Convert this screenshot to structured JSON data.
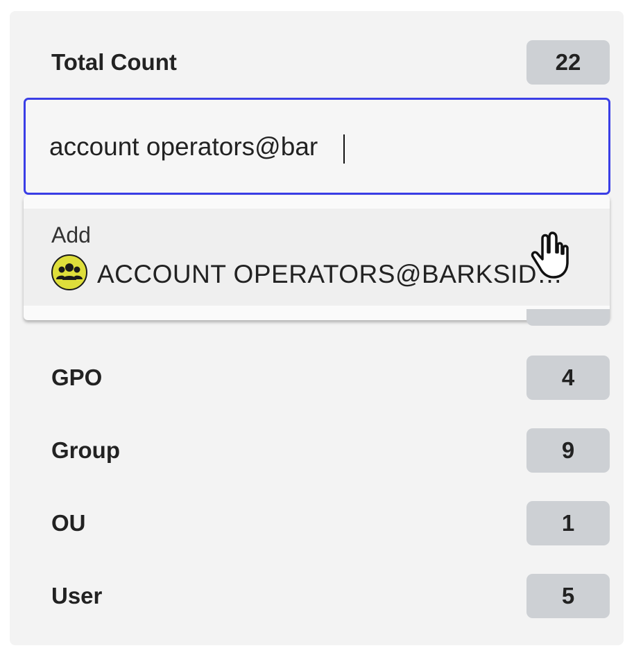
{
  "summary": {
    "total_label": "Total Count",
    "total_value": "22"
  },
  "search": {
    "value": "account operators@bar",
    "placeholder": ""
  },
  "dropdown": {
    "action_label": "Add",
    "option_icon": "group-icon",
    "option_text": "ACCOUNT OPERATORS@BARKSIDE.LOCAL"
  },
  "rows": [
    {
      "label": "GPO",
      "count": "4"
    },
    {
      "label": "Group",
      "count": "9"
    },
    {
      "label": "OU",
      "count": "1"
    },
    {
      "label": "User",
      "count": "5"
    }
  ],
  "colors": {
    "focus_border": "#3a3ee6",
    "badge_bg": "#cdd0d4",
    "group_icon_bg": "#dede3b",
    "panel_bg": "#f3f3f3"
  }
}
